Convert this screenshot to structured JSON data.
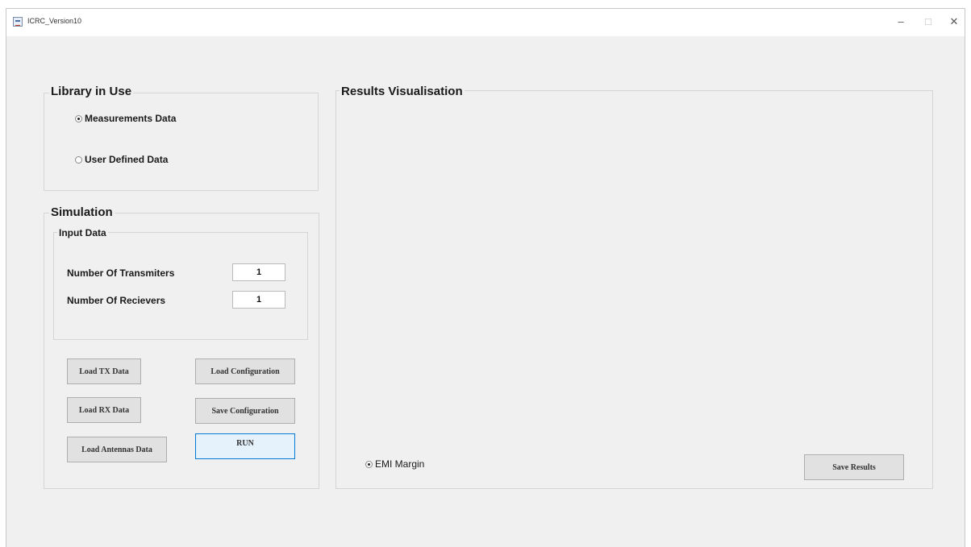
{
  "window": {
    "title": "ICRC_Version10",
    "controls": {
      "minimize": "–",
      "maximize": "□",
      "close": "✕"
    }
  },
  "library": {
    "title": "Library in Use",
    "options": [
      {
        "label": "Measurements Data",
        "selected": true
      },
      {
        "label": "User Defined Data",
        "selected": false
      }
    ]
  },
  "simulation": {
    "title": "Simulation",
    "input_data": {
      "title": "Input Data",
      "fields": [
        {
          "label": "Number Of Transmiters",
          "value": "1"
        },
        {
          "label": "Number Of Recievers",
          "value": "1"
        }
      ]
    },
    "buttons": {
      "load_tx": "Load TX Data",
      "load_config": "Load Configuration",
      "load_rx": "Load RX Data",
      "save_config": "Save Configuration",
      "load_antennas": "Load Antennas Data",
      "run": "RUN"
    }
  },
  "results": {
    "title": "Results Visualisation",
    "emi_option": {
      "label": "EMI Margin",
      "selected": true
    },
    "save_button": "Save Results"
  }
}
